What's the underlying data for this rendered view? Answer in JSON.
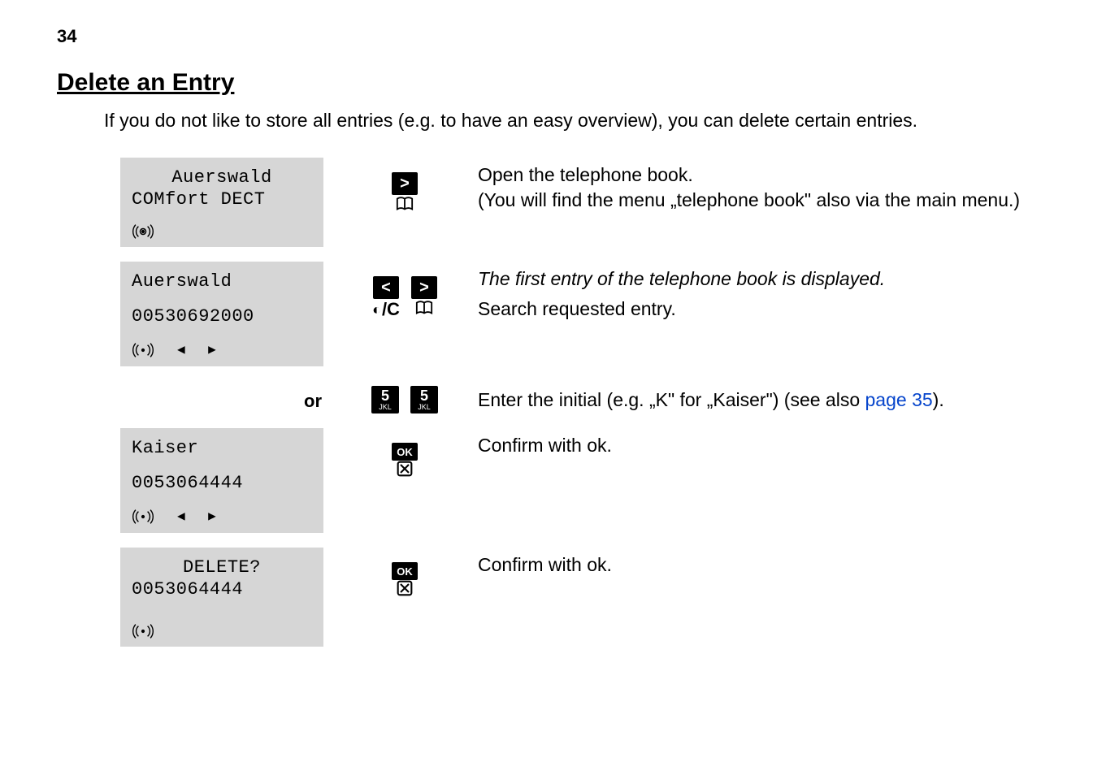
{
  "page_number": "34",
  "title": "Delete an Entry",
  "intro": "If you do not like to store all entries (e.g. to have an easy overview), you can delete certain entries.",
  "steps": [
    {
      "screen": {
        "line1": "Auerswald",
        "line1_align": "center",
        "line2": "COMfort DECT",
        "line2_align": "center",
        "show_arrows": false
      },
      "icons": [
        {
          "type": "gt",
          "sub": "book"
        }
      ],
      "desc_plain1": "Open the telephone book.",
      "desc_plain2": "(You will find the menu „telephone book\" also via the main menu.)"
    },
    {
      "screen": {
        "line1": "Auerswald",
        "line2": "00530692000",
        "show_arrows": true,
        "gap_before_line2": true
      },
      "icons": [
        {
          "type": "lt",
          "sub": "cc"
        },
        {
          "type": "gt",
          "sub": "book"
        }
      ],
      "desc_italic": "The first entry of the telephone book is displayed.",
      "desc_plain1": "Search requested entry."
    },
    {
      "or_label": "or",
      "icons": [
        {
          "type": "5jkl"
        },
        {
          "type": "5jkl"
        }
      ],
      "desc_plain1": "Enter the initial (e.g. „K\" for „Kaiser\") (see also ",
      "page_link": "page 35",
      "desc_plain2": ")."
    },
    {
      "screen": {
        "line1": "Kaiser",
        "line2": "0053064444",
        "show_arrows": true,
        "gap_before_line2": true
      },
      "icons": [
        {
          "type": "ok",
          "sub": "x"
        }
      ],
      "desc_plain1": "Confirm with ok."
    },
    {
      "screen": {
        "line1": "DELETE?",
        "line1_align": "center",
        "line2": "0053064444",
        "line2_align": "center",
        "show_arrows": false
      },
      "icons": [
        {
          "type": "ok",
          "sub": "x"
        }
      ],
      "desc_plain1": "Confirm with ok."
    }
  ]
}
